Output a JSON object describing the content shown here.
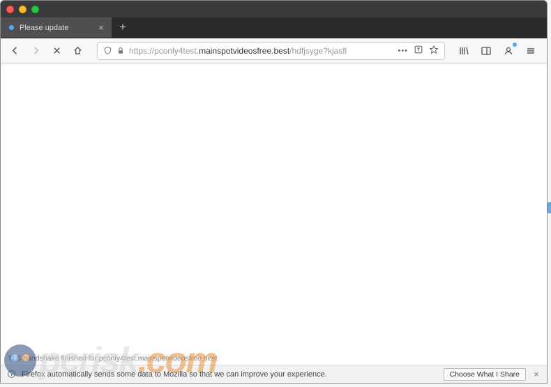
{
  "tab": {
    "title": "Please update",
    "loading_indicator": "•"
  },
  "url": {
    "protocol": "https://",
    "subdomain": "pconly4test.",
    "domain": "mainspotvideosfree.best",
    "path": "/hdfjsyge?kjasfl"
  },
  "status_text": "TLS handshake finished for pconly4test.mainspotvideosfree.best",
  "notice": {
    "text": "Firefox automatically sends some data to Mozilla so that we can improve your experience.",
    "button": "Choose What I Share"
  },
  "icons": {
    "close": "×",
    "plus": "+",
    "dots": "•••"
  },
  "watermark": {
    "brand": "pcrisk",
    "tld": ".com"
  }
}
